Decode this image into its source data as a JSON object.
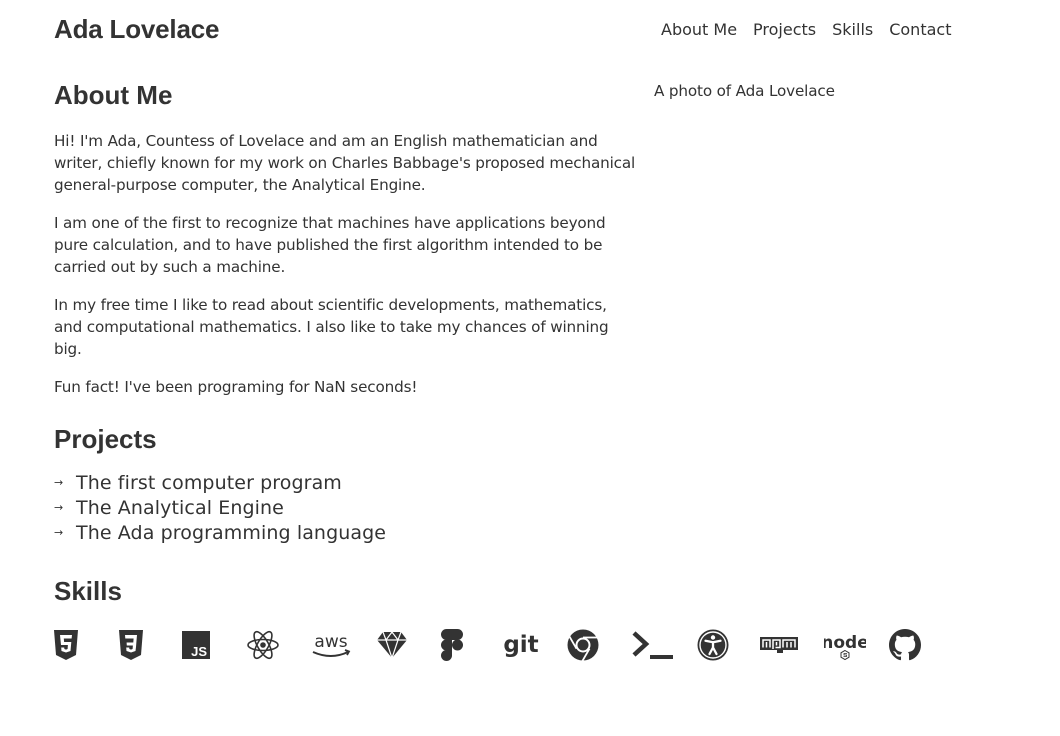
{
  "header": {
    "site_name": "Ada Lovelace",
    "nav": [
      "About Me",
      "Projects",
      "Skills",
      "Contact"
    ]
  },
  "about": {
    "heading": "About Me",
    "paragraphs": [
      "Hi! I'm Ada, Countess of Lovelace and am an English mathematician and writer, chiefly known for my work on Charles Babbage's proposed mechanical general-purpose computer, the Analytical Engine.",
      "I am one of the first to recognize that machines have applications beyond pure calculation, and to have published the first algorithm intended to be carried out by such a machine.",
      "In my free time I like to read about scientific developments, mathematics, and computational mathematics. I also like to take my chances of winning big.",
      "Fun fact! I've been programing for NaN seconds!"
    ],
    "photo_alt": "A photo of Ada Lovelace"
  },
  "projects": {
    "heading": "Projects",
    "arrow": "→",
    "items": [
      "The first computer program",
      "The Analytical Engine",
      "The Ada programming language"
    ]
  },
  "skills": {
    "heading": "Skills",
    "icons": [
      "html5-icon",
      "css3-icon",
      "javascript-icon",
      "react-icon",
      "aws-icon",
      "sketch-icon",
      "figma-icon",
      "git-icon",
      "chrome-icon",
      "terminal-icon",
      "accessibility-icon",
      "npm-icon",
      "nodejs-icon",
      "github-icon"
    ],
    "labels": {
      "aws": "aws",
      "git": "git",
      "js": "JS",
      "npm": "npm",
      "node": "node"
    }
  },
  "colors": {
    "text": "#333333",
    "background": "#ffffff"
  }
}
